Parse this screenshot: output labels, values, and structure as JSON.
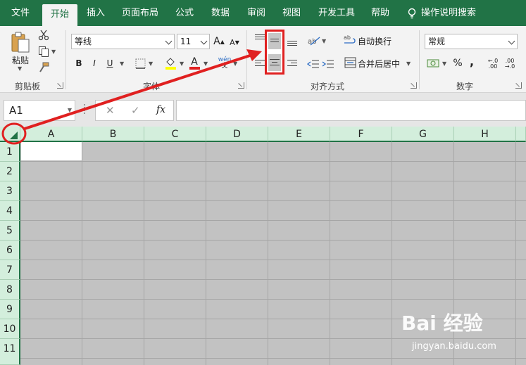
{
  "tabs": [
    {
      "label": "文件"
    },
    {
      "label": "开始"
    },
    {
      "label": "插入"
    },
    {
      "label": "页面布局"
    },
    {
      "label": "公式"
    },
    {
      "label": "数据"
    },
    {
      "label": "审阅"
    },
    {
      "label": "视图"
    },
    {
      "label": "开发工具"
    },
    {
      "label": "帮助"
    },
    {
      "label": "操作说明搜索"
    }
  ],
  "clipboard": {
    "paste_label": "粘贴",
    "group_label": "剪贴板"
  },
  "font": {
    "name": "等线",
    "size": "11",
    "group_label": "字体",
    "bold": "B",
    "italic": "I",
    "underline": "U",
    "color_glyph": "A"
  },
  "alignment": {
    "wrap_label": "自动换行",
    "merge_label": "合并后居中",
    "group_label": "对齐方式"
  },
  "number": {
    "format": "常规",
    "percent": "%",
    "comma": ",",
    "group_label": "数字"
  },
  "formula_bar": {
    "name_box": "A1",
    "cancel_glyph": "✕",
    "enter_glyph": "✓",
    "fx_glyph": "fx",
    "value": ""
  },
  "columns": [
    "A",
    "B",
    "C",
    "D",
    "E",
    "F",
    "G",
    "H"
  ],
  "rows": [
    "1",
    "2",
    "3",
    "4",
    "5",
    "6",
    "7",
    "8",
    "9",
    "10",
    "11"
  ],
  "watermark": {
    "main": "Bai 经验",
    "sub": "jingyan.baidu.com"
  },
  "colors": {
    "excel_green": "#217346",
    "annotation_red": "#e02020",
    "selection_gray": "#c2c2c2"
  }
}
